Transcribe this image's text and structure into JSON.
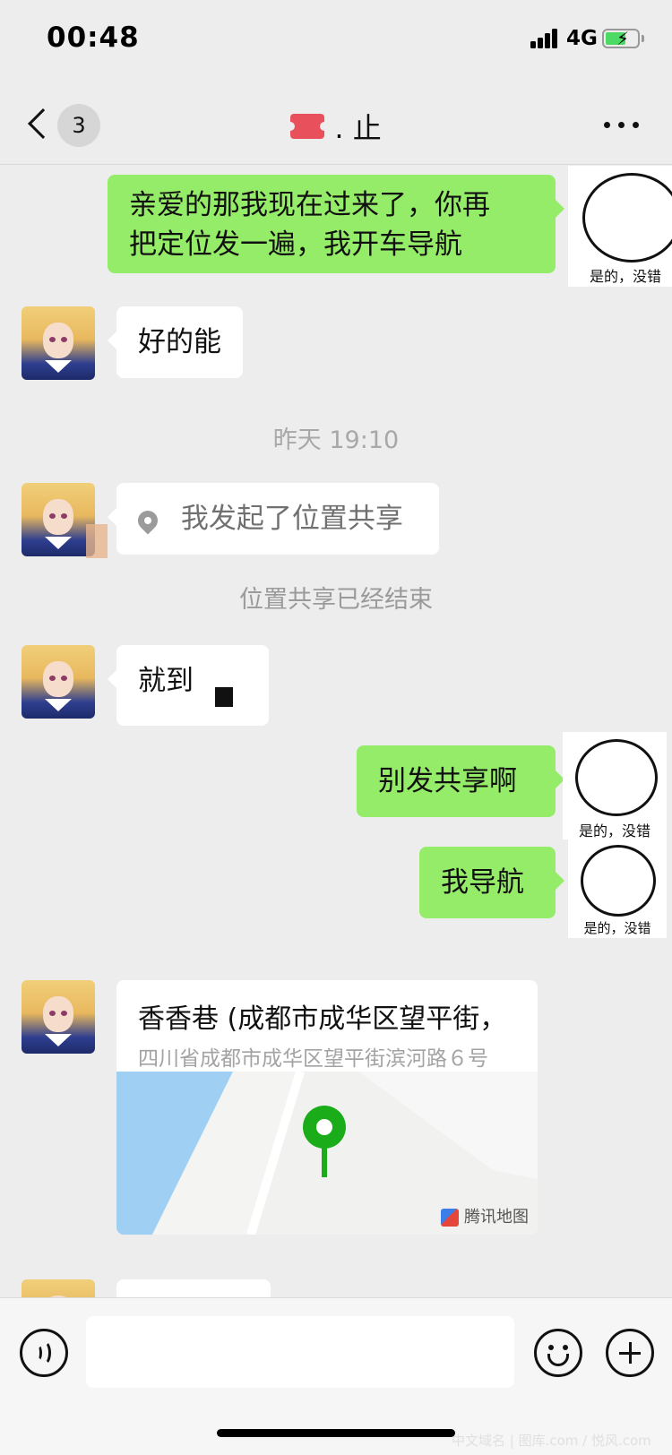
{
  "status_bar": {
    "time": "00:48",
    "network": "4G"
  },
  "header": {
    "unread_count": "3",
    "title": ".   止"
  },
  "messages": {
    "m1_text_line1": "亲爱的那我现在过来了，你再",
    "m1_text_line2": "把定位发一遍，我开车导航",
    "m2_text": "好的能",
    "timestamp": "昨天 19:10",
    "m3_text": "我发起了位置共享",
    "system_note": "位置共享已经结束",
    "m4_text": "就到",
    "m5_text": "别发共享啊",
    "m6_text": "我导航"
  },
  "stickers": {
    "caption": "是的，没错"
  },
  "location_card": {
    "title": "香香巷 (成都市成华区望平街，",
    "address": "四川省成都市成华区望平街滨河路６号",
    "map_brand": "腾讯地图"
  },
  "input_bar": {
    "placeholder": ""
  },
  "watermark": "中文域名 | 图库.com / 悦风.com",
  "colors": {
    "outgoing_bubble": "#95ec69",
    "incoming_bubble": "#ffffff",
    "background": "#ededed",
    "map_pin": "#1aad19"
  }
}
